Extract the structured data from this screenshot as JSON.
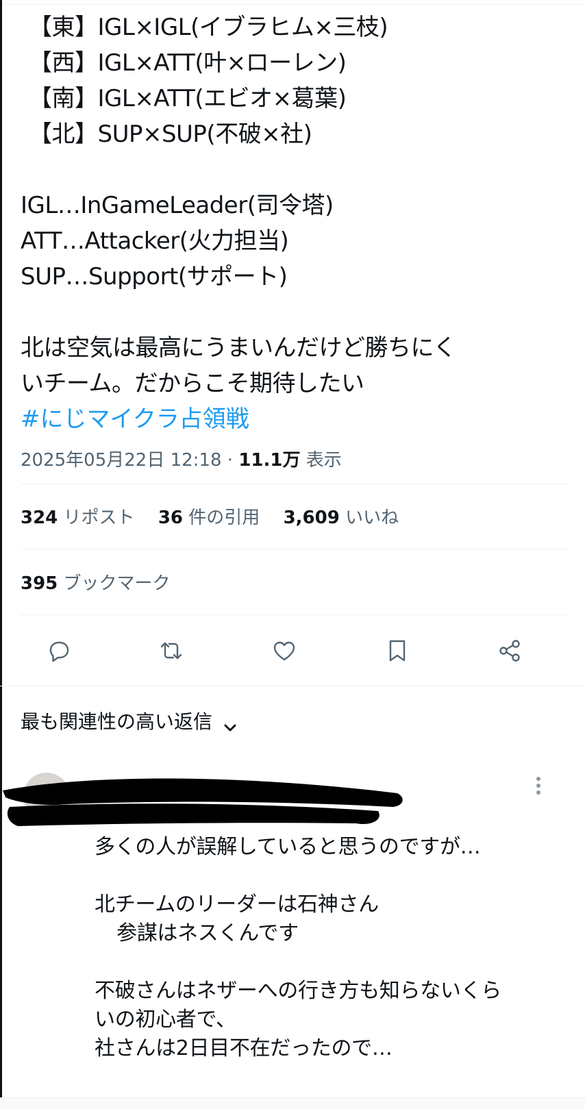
{
  "tweet": {
    "teams": [
      "【東】IGL×IGL(イブラヒム×三枝)",
      "【西】IGL×ATT(叶×ローレン)",
      "【南】IGL×ATT(エビオ×葛葉)",
      "【北】SUP×SUP(不破×社)"
    ],
    "roles": [
      "IGL…InGameLeader(司令塔)",
      "ATT…Attacker(火力担当)",
      "SUP…Support(サポート)"
    ],
    "comment": [
      "北は空気は最高にうまいんだけど勝ちにく",
      "いチーム。だからこそ期待したい"
    ],
    "hashtag": "#にじマイクラ占領戦",
    "timestamp": "2025年05月22日 12:18",
    "separator": " · ",
    "views_count": "11.1万",
    "views_label": "表示"
  },
  "stats": {
    "reposts_count": "324",
    "reposts_label": "リポスト",
    "quotes_count": "36",
    "quotes_label": "件の引用",
    "likes_count": "3,609",
    "likes_label": "いいね",
    "bookmarks_count": "395",
    "bookmarks_label": "ブックマーク"
  },
  "actions": {
    "icons": [
      "reply-icon",
      "retweet-icon",
      "like-icon",
      "bookmark-icon",
      "share-icon"
    ]
  },
  "replies_sort": {
    "label": "最も関連性の高い返信"
  },
  "reply": {
    "lines": [
      "多くの人が誤解していると思うのですが…",
      "",
      "北チームのリーダーは石神さん",
      "参謀はネスくんです",
      "",
      "不破さんはネザーへの行き方も知らないくら",
      "いの初心者で、",
      "社さんは2日目不在だったので…"
    ]
  },
  "colors": {
    "text": "#0f1419",
    "secondary": "#536471",
    "link": "#1d9bf0",
    "divider": "#eff3f4"
  }
}
